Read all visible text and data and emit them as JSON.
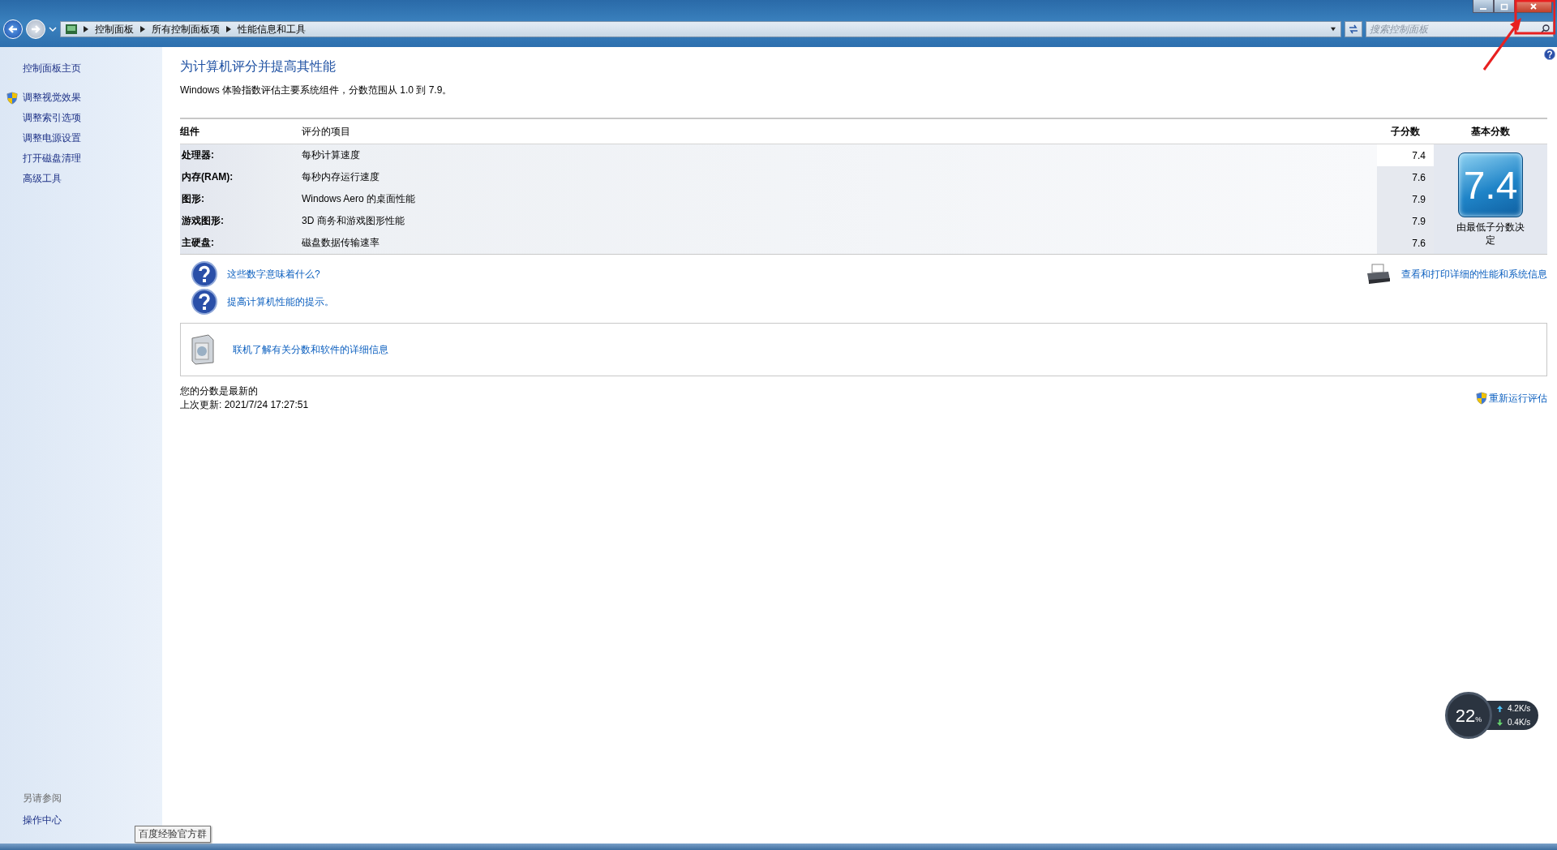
{
  "address_bar": {
    "breadcrumbs": [
      "控制面板",
      "所有控制面板项",
      "性能信息和工具"
    ]
  },
  "search": {
    "placeholder": "搜索控制面板"
  },
  "sidebar": {
    "items": [
      {
        "label": "控制面板主页",
        "kind": "home"
      },
      {
        "label": "调整视觉效果",
        "kind": "shield"
      },
      {
        "label": "调整索引选项",
        "kind": "plain"
      },
      {
        "label": "调整电源设置",
        "kind": "plain"
      },
      {
        "label": "打开磁盘清理",
        "kind": "plain"
      },
      {
        "label": "高级工具",
        "kind": "plain"
      }
    ],
    "see_also": {
      "heading": "另请参阅",
      "items": [
        "操作中心"
      ]
    }
  },
  "main": {
    "title": "为计算机评分并提高其性能",
    "description": "Windows 体验指数评估主要系统组件，分数范围从 1.0 到 7.9。",
    "table": {
      "columns": [
        "组件",
        "评分的项目",
        "子分数",
        "基本分数"
      ],
      "rows": [
        {
          "component": "处理器:",
          "item": "每秒计算速度",
          "subscore": "7.4",
          "highlighted": true
        },
        {
          "component": "内存(RAM):",
          "item": "每秒内存运行速度",
          "subscore": "7.6",
          "highlighted": false
        },
        {
          "component": "图形:",
          "item": "Windows Aero 的桌面性能",
          "subscore": "7.9",
          "highlighted": false
        },
        {
          "component": "游戏图形:",
          "item": "3D 商务和游戏图形性能",
          "subscore": "7.9",
          "highlighted": false
        },
        {
          "component": "主硬盘:",
          "item": "磁盘数据传输速率",
          "subscore": "7.6",
          "highlighted": false
        }
      ]
    },
    "base_score": {
      "value": "7.4",
      "caption": "由最低子分数决定"
    },
    "help_links": [
      "这些数字意味着什么?",
      "提高计算机性能的提示。"
    ],
    "print_link": "查看和打印详细的性能和系统信息",
    "online_link": "联机了解有关分数和软件的详细信息",
    "status": {
      "line_1": "您的分数是最新的",
      "line_2": "上次更新: 2021/7/24 17:27:51"
    },
    "rerun": "重新运行评估"
  },
  "tooltip": "百度经验官方群",
  "net_monitor": {
    "cpu": "22",
    "unit": "%",
    "up": "4.2K/s",
    "down": "0.4K/s"
  }
}
